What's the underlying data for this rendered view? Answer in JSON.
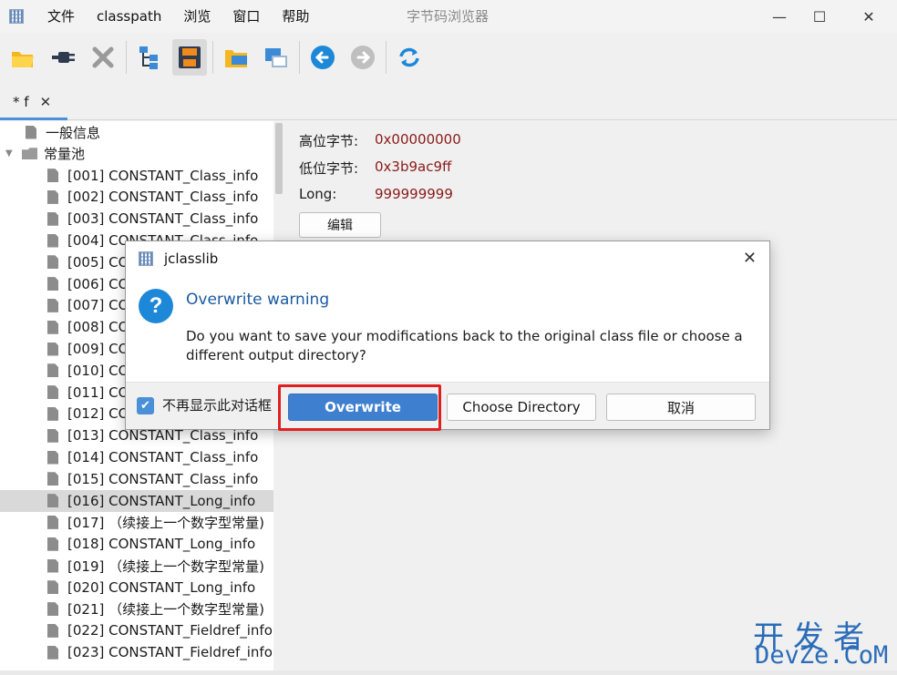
{
  "window": {
    "title": "字节码浏览器",
    "menu": [
      "文件",
      "classpath",
      "浏览",
      "窗口",
      "帮助"
    ],
    "controls": {
      "minimize": "—",
      "maximize": "☐",
      "close": "✕"
    }
  },
  "toolbar": {
    "buttons": [
      {
        "name": "open-icon"
      },
      {
        "name": "connect-icon"
      },
      {
        "name": "close-file-icon"
      },
      {
        "name": "tree-icon"
      },
      {
        "name": "save-icon"
      },
      {
        "name": "browse-folder-icon"
      },
      {
        "name": "browse-window-icon"
      },
      {
        "name": "back-icon"
      },
      {
        "name": "forward-icon"
      },
      {
        "name": "reload-icon"
      }
    ]
  },
  "tab": {
    "label": "* f",
    "close": "✕"
  },
  "tree": {
    "items": [
      {
        "label": "一般信息",
        "type": "doc",
        "level": 1
      },
      {
        "label": "常量池",
        "type": "folder",
        "level": 0
      },
      {
        "label": "[001] CONSTANT_Class_info",
        "type": "doc",
        "level": 2
      },
      {
        "label": "[002] CONSTANT_Class_info",
        "type": "doc",
        "level": 2
      },
      {
        "label": "[003] CONSTANT_Class_info",
        "type": "doc",
        "level": 2
      },
      {
        "label": "[004] CONSTANT_Class_info",
        "type": "doc",
        "level": 2
      },
      {
        "label": "[005] CONSTANT_Class_info",
        "type": "doc",
        "level": 2
      },
      {
        "label": "[006] CONSTANT_Class_info",
        "type": "doc",
        "level": 2
      },
      {
        "label": "[007] CONSTANT_Class_info",
        "type": "doc",
        "level": 2
      },
      {
        "label": "[008] CONSTANT_Class_info",
        "type": "doc",
        "level": 2
      },
      {
        "label": "[009] CONSTANT_Class_info",
        "type": "doc",
        "level": 2
      },
      {
        "label": "[010] CONSTANT_Class_info",
        "type": "doc",
        "level": 2
      },
      {
        "label": "[011] CONSTANT_Class_info",
        "type": "doc",
        "level": 2
      },
      {
        "label": "[012] CONSTANT_Class_info",
        "type": "doc",
        "level": 2
      },
      {
        "label": "[013] CONSTANT_Class_info",
        "type": "doc",
        "level": 2
      },
      {
        "label": "[014] CONSTANT_Class_info",
        "type": "doc",
        "level": 2
      },
      {
        "label": "[015] CONSTANT_Class_info",
        "type": "doc",
        "level": 2
      },
      {
        "label": "[016] CONSTANT_Long_info",
        "type": "doc",
        "level": 2,
        "selected": true
      },
      {
        "label": "[017] （续接上一个数字型常量)",
        "type": "doc",
        "level": 2
      },
      {
        "label": "[018] CONSTANT_Long_info",
        "type": "doc",
        "level": 2
      },
      {
        "label": "[019] （续接上一个数字型常量)",
        "type": "doc",
        "level": 2
      },
      {
        "label": "[020] CONSTANT_Long_info",
        "type": "doc",
        "level": 2
      },
      {
        "label": "[021] （续接上一个数字型常量)",
        "type": "doc",
        "level": 2
      },
      {
        "label": "[022] CONSTANT_Fieldref_info",
        "type": "doc",
        "level": 2
      },
      {
        "label": "[023] CONSTANT_Fieldref_info",
        "type": "doc",
        "level": 2
      }
    ]
  },
  "detail": {
    "high_bytes_label": "高位字节:",
    "high_bytes_value": "0x00000000",
    "low_bytes_label": "低位字节:",
    "low_bytes_value": "0x3b9ac9ff",
    "long_label": "Long:",
    "long_value": "999999999",
    "edit_button": "编辑"
  },
  "dialog": {
    "title": "jclasslib",
    "close": "✕",
    "icon": "question-icon",
    "heading": "Overwrite warning",
    "message": "Do you want to save your modifications back to the original class file or choose a different output directory?",
    "checkbox_label": "不再显示此对话框",
    "checkbox_checked": true,
    "buttons": {
      "overwrite": "Overwrite",
      "choose": "Choose Directory",
      "cancel": "取消"
    }
  },
  "watermark": {
    "top": "开发者",
    "bottom": "DevZe.CoM"
  },
  "colors": {
    "accent": "#3f7fcf",
    "highlight": "#e02020",
    "value_text": "#8b1a1a",
    "heading": "#1a5aa0"
  }
}
